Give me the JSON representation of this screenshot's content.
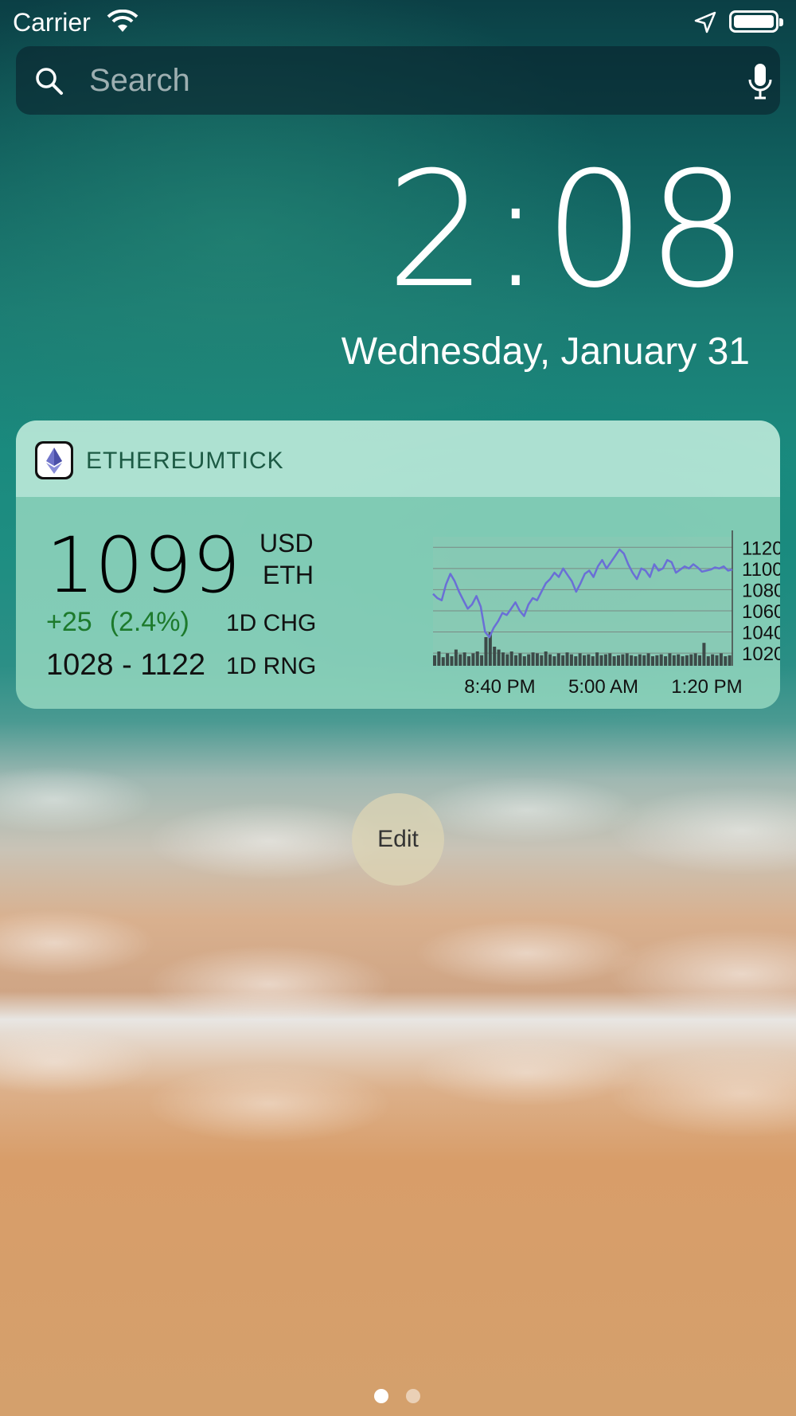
{
  "status_bar": {
    "carrier": "Carrier"
  },
  "search": {
    "placeholder": "Search"
  },
  "lock": {
    "time": "2:08",
    "date": "Wednesday, January 31"
  },
  "widget": {
    "app_name": "ETHEREUMTICK",
    "price": "1099",
    "currency_top": "USD",
    "currency_bottom": "ETH",
    "change": "+25",
    "change_pct": "(2.4%)",
    "change_label": "1D CHG",
    "range": "1028 - 1122",
    "range_label": "1D RNG"
  },
  "edit_label": "Edit",
  "page_indicator": {
    "pages": 2,
    "current": 1
  },
  "colors": {
    "line": "#6a6fd6",
    "positive": "#1d7a2c"
  },
  "chart_data": {
    "type": "line",
    "x_tick_labels": [
      "8:40 PM",
      "5:00 AM",
      "1:20 PM"
    ],
    "y_ticks": [
      1120,
      1100,
      1080,
      1060,
      1040,
      1020
    ],
    "ylim": [
      1008,
      1130
    ],
    "series": [
      {
        "values": [
          1076,
          1072,
          1070,
          1085,
          1095,
          1088,
          1078,
          1070,
          1062,
          1066,
          1074,
          1064,
          1040,
          1035,
          1044,
          1050,
          1058,
          1056,
          1062,
          1068,
          1060,
          1055,
          1066,
          1072,
          1070,
          1078,
          1086,
          1090,
          1096,
          1092,
          1100,
          1094,
          1088,
          1078,
          1086,
          1095,
          1098,
          1092,
          1102,
          1108,
          1100,
          1106,
          1112,
          1118,
          1114,
          1104,
          1096,
          1090,
          1100,
          1098,
          1092,
          1104,
          1098,
          1100,
          1108,
          1106,
          1096,
          1099,
          1102,
          1100,
          1104,
          1101,
          1097,
          1098,
          1099,
          1101,
          1100,
          1102,
          1098,
          1099
        ]
      }
    ],
    "volume": [
      22,
      30,
      18,
      26,
      20,
      34,
      24,
      28,
      20,
      26,
      30,
      22,
      60,
      70,
      40,
      34,
      28,
      24,
      30,
      22,
      26,
      20,
      24,
      28,
      26,
      22,
      30,
      24,
      20,
      26,
      22,
      28,
      24,
      20,
      26,
      22,
      24,
      20,
      28,
      22,
      24,
      26,
      20,
      22,
      24,
      26,
      22,
      20,
      24,
      22,
      26,
      20,
      22,
      24,
      20,
      26,
      22,
      24,
      20,
      22,
      24,
      26,
      22,
      48,
      20,
      24,
      22,
      26,
      20,
      22
    ]
  }
}
